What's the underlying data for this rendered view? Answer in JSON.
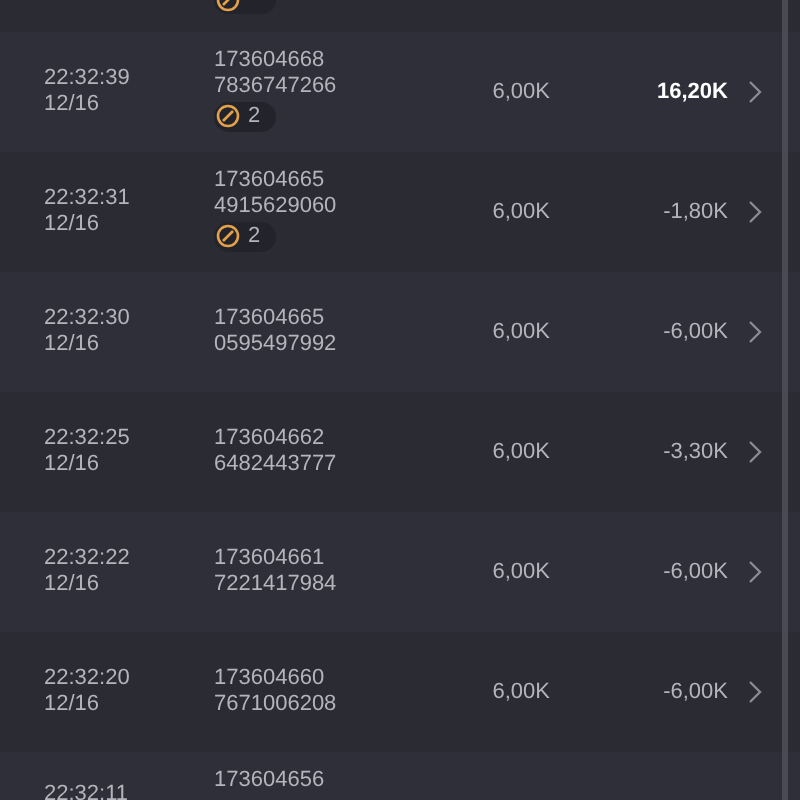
{
  "rows": [
    {
      "kind": "cut-top",
      "badge": {}
    },
    {
      "kind": "full",
      "time": "22:32:39",
      "date": "12/16",
      "ids": [
        "173604668",
        "7836747266"
      ],
      "badge": {
        "count": "2"
      },
      "amount": "6,00K",
      "result": "16,20K",
      "highlight": true
    },
    {
      "kind": "full",
      "time": "22:32:31",
      "date": "12/16",
      "ids": [
        "173604665",
        "4915629060"
      ],
      "badge": {
        "count": "2"
      },
      "amount": "6,00K",
      "result": "-1,80K",
      "highlight": false
    },
    {
      "kind": "full",
      "time": "22:32:30",
      "date": "12/16",
      "ids": [
        "173604665",
        "0595497992"
      ],
      "amount": "6,00K",
      "result": "-6,00K",
      "highlight": false
    },
    {
      "kind": "full",
      "time": "22:32:25",
      "date": "12/16",
      "ids": [
        "173604662",
        "6482443777"
      ],
      "amount": "6,00K",
      "result": "-3,30K",
      "highlight": false
    },
    {
      "kind": "full",
      "time": "22:32:22",
      "date": "12/16",
      "ids": [
        "173604661",
        "7221417984"
      ],
      "amount": "6,00K",
      "result": "-6,00K",
      "highlight": false
    },
    {
      "kind": "full",
      "time": "22:32:20",
      "date": "12/16",
      "ids": [
        "173604660",
        "7671006208"
      ],
      "amount": "6,00K",
      "result": "-6,00K",
      "highlight": false
    },
    {
      "kind": "cut-bottom",
      "time": "22:32:11",
      "ids": [
        "173604656"
      ]
    }
  ]
}
